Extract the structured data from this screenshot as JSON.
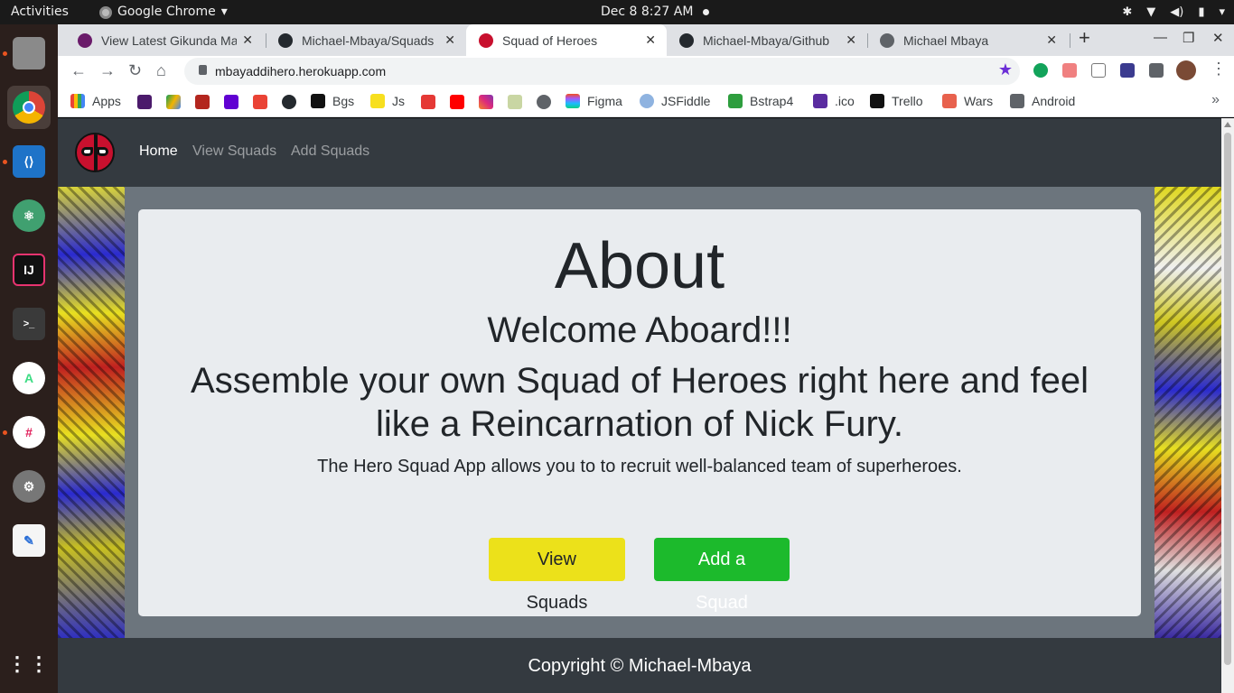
{
  "system": {
    "activities": "Activities",
    "app_name": "Google Chrome",
    "app_caret": "▾",
    "clock": "Dec 8   8:27 AM"
  },
  "tabs": [
    {
      "label": "View Latest Gikunda Ma",
      "color": "#6a1b6a"
    },
    {
      "label": "Michael-Mbaya/Squads",
      "color": "#24292e"
    },
    {
      "label": "Squad of Heroes",
      "color": "#c8102e"
    },
    {
      "label": "Michael-Mbaya/Github",
      "color": "#24292e"
    },
    {
      "label": "Michael Mbaya",
      "color": "#5f6368"
    }
  ],
  "address_bar": {
    "url": "mbayaddihero.herokuapp.com"
  },
  "bookmarks": [
    {
      "label": "Apps"
    },
    {
      "label": "Bgs"
    },
    {
      "label": "Js"
    },
    {
      "label": "Figma"
    },
    {
      "label": "JSFiddle"
    },
    {
      "label": "Bstrap4"
    },
    {
      "label": ".ico"
    },
    {
      "label": "Trello"
    },
    {
      "label": "Wars"
    },
    {
      "label": "Android"
    }
  ],
  "site": {
    "nav": {
      "home": "Home",
      "view_squads": "View Squads",
      "add_squads": "Add Squads"
    },
    "about": {
      "title": "About",
      "welcome": "Welcome Aboard!!!",
      "tagline": "Assemble your own Squad of Heroes right here and feel like a Reincarnation of Nick Fury.",
      "description": "The Hero Squad App allows you to to recruit well-balanced team of superheroes.",
      "btn_view": "View Squads",
      "btn_add": "Add a Squad"
    },
    "footer": "Copyright © Michael-Mbaya"
  }
}
